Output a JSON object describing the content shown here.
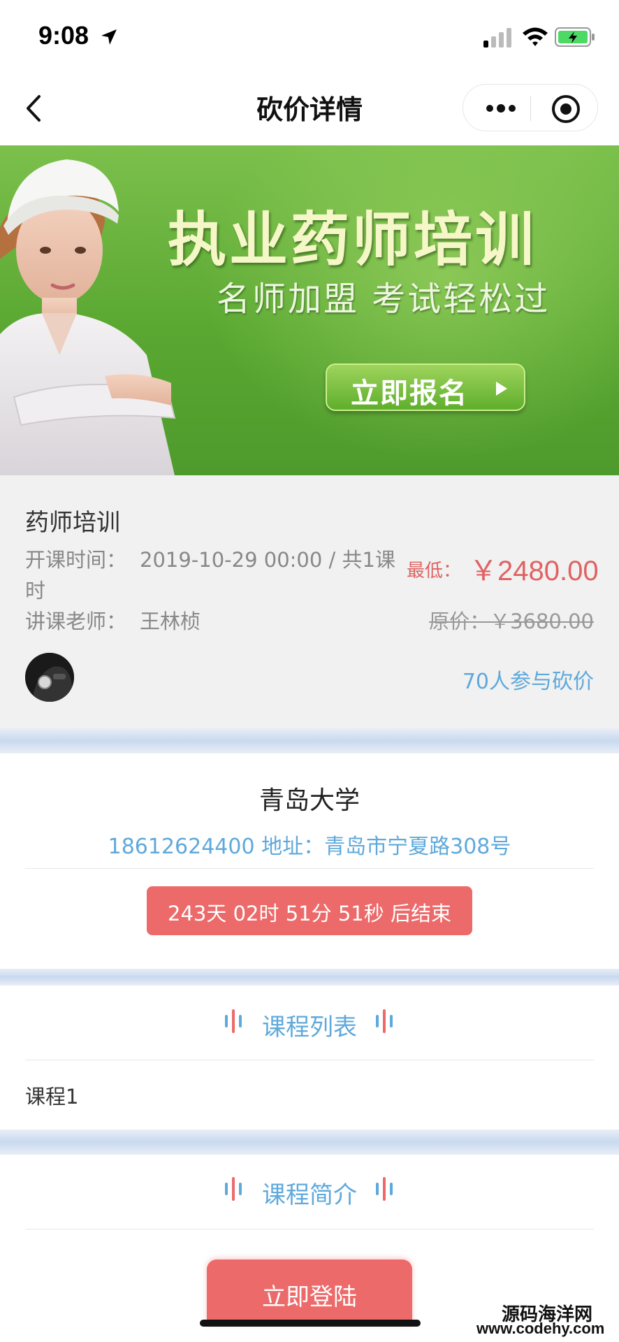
{
  "status_bar": {
    "time": "9:08"
  },
  "nav": {
    "title": "砍价详情"
  },
  "banner": {
    "title": "执业药师培训",
    "subtitle": "名师加盟 考试轻松过",
    "cta_label": "立即报名"
  },
  "course": {
    "name": "药师培训",
    "start_label": "开课时间：",
    "start_value": "2019-10-29 00:00 / 共1课",
    "start_wrap": "时",
    "teacher_label": "讲课老师：",
    "teacher_value": "王林桢",
    "min_label": "最低：",
    "min_price": "￥2480.00",
    "original_price": "原价：￥3680.00",
    "participants": "70人参与砍价"
  },
  "school": {
    "name": "青岛大学",
    "contact": "18612624400   地址：青岛市宁夏路308号",
    "countdown": "243天 02时 51分 51秒 后结束"
  },
  "course_list": {
    "title": "课程列表",
    "items": [
      "课程1"
    ]
  },
  "course_intro": {
    "title": "课程简介"
  },
  "bottom": {
    "login_label": "立即登陆"
  },
  "watermark": {
    "name": "源码海洋网",
    "url": "www.codehy.com"
  },
  "colors": {
    "accent_red": "#ec6a6a",
    "price_red": "#e06262",
    "link_blue": "#5fa9db",
    "banner_green": "#5aa832"
  }
}
